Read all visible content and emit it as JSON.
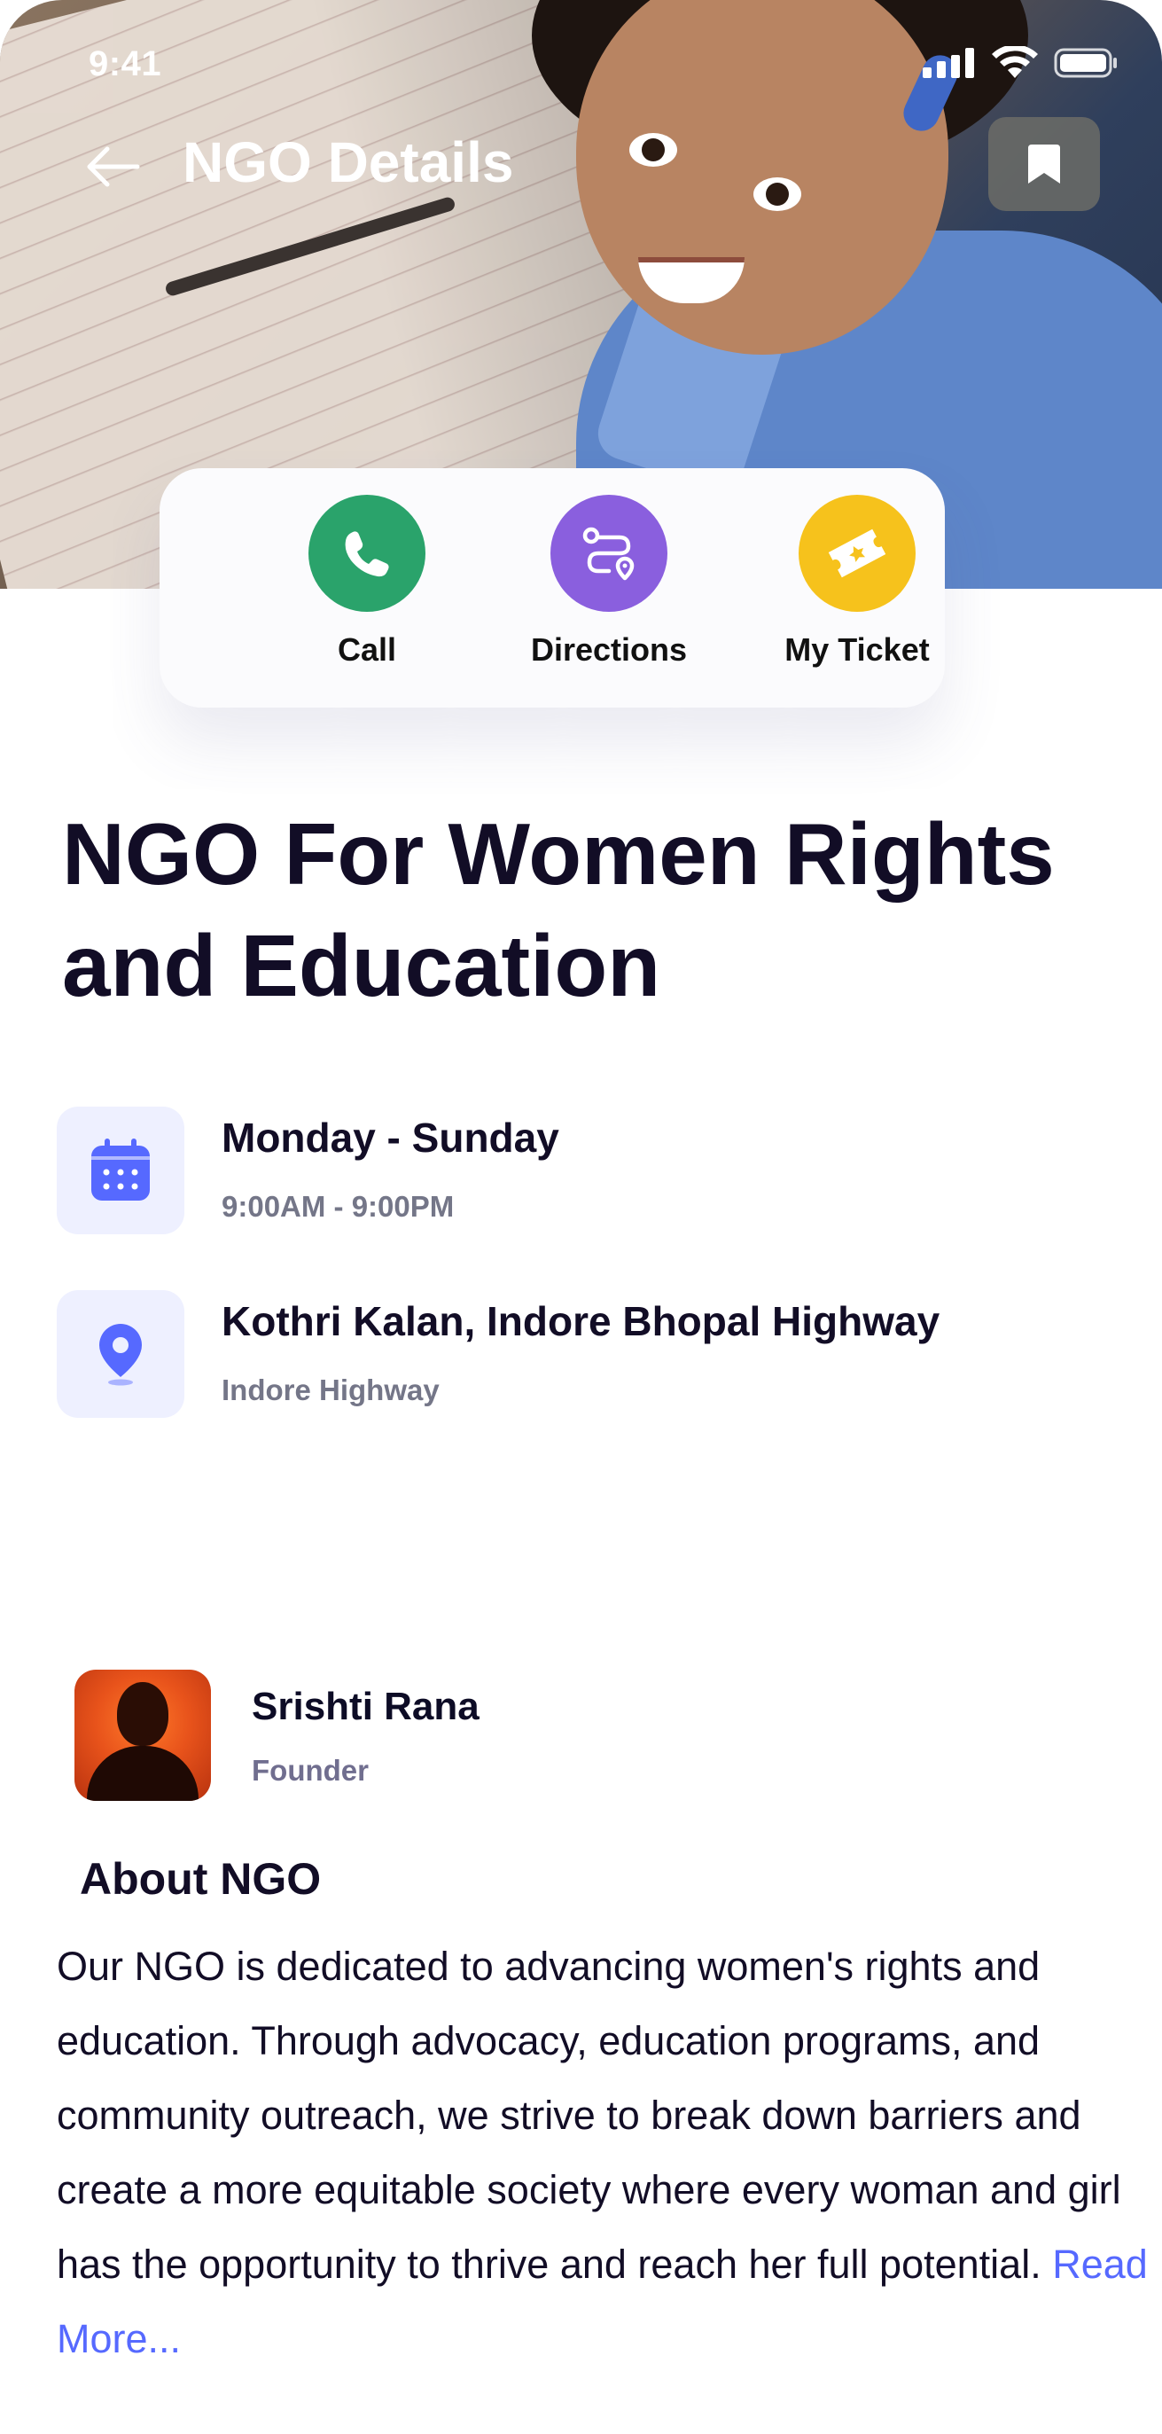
{
  "status_bar": {
    "time": "9:41",
    "icons": [
      "cellular-signal-icon",
      "wifi-icon",
      "battery-icon"
    ]
  },
  "header": {
    "title": "NGO Details",
    "back_icon": "arrow-left-icon",
    "bookmark_icon": "bookmark-icon"
  },
  "actions": [
    {
      "label": "Call",
      "icon": "phone-icon",
      "color": "#2aa36b"
    },
    {
      "label": "Directions",
      "icon": "route-icon",
      "color": "#8a5fde"
    },
    {
      "label": "My Ticket",
      "icon": "ticket-icon",
      "color": "#f6c21c"
    }
  ],
  "ngo": {
    "title": "NGO For Women Rights and Education",
    "schedule": {
      "days": "Monday - Sunday",
      "hours": "9:00AM - 9:00PM",
      "icon": "calendar-icon"
    },
    "location": {
      "address": "Kothri Kalan, Indore Bhopal Highway",
      "area": "Indore Highway",
      "icon": "location-pin-icon"
    }
  },
  "organizer": {
    "name": "Srishti Rana",
    "role": "Founder"
  },
  "about": {
    "title": "About NGO",
    "text": "Our NGO is dedicated to advancing women's rights and education. Through advocacy, education programs, and community outreach, we strive to break down barriers and create a more equitable society where every woman and girl has the opportunity to thrive and reach her full potential.",
    "read_more": "Read More..."
  },
  "colors": {
    "accent": "#5669ff",
    "title": "#120d26",
    "muted": "#747688",
    "icon_bg": "#eef0ff"
  }
}
